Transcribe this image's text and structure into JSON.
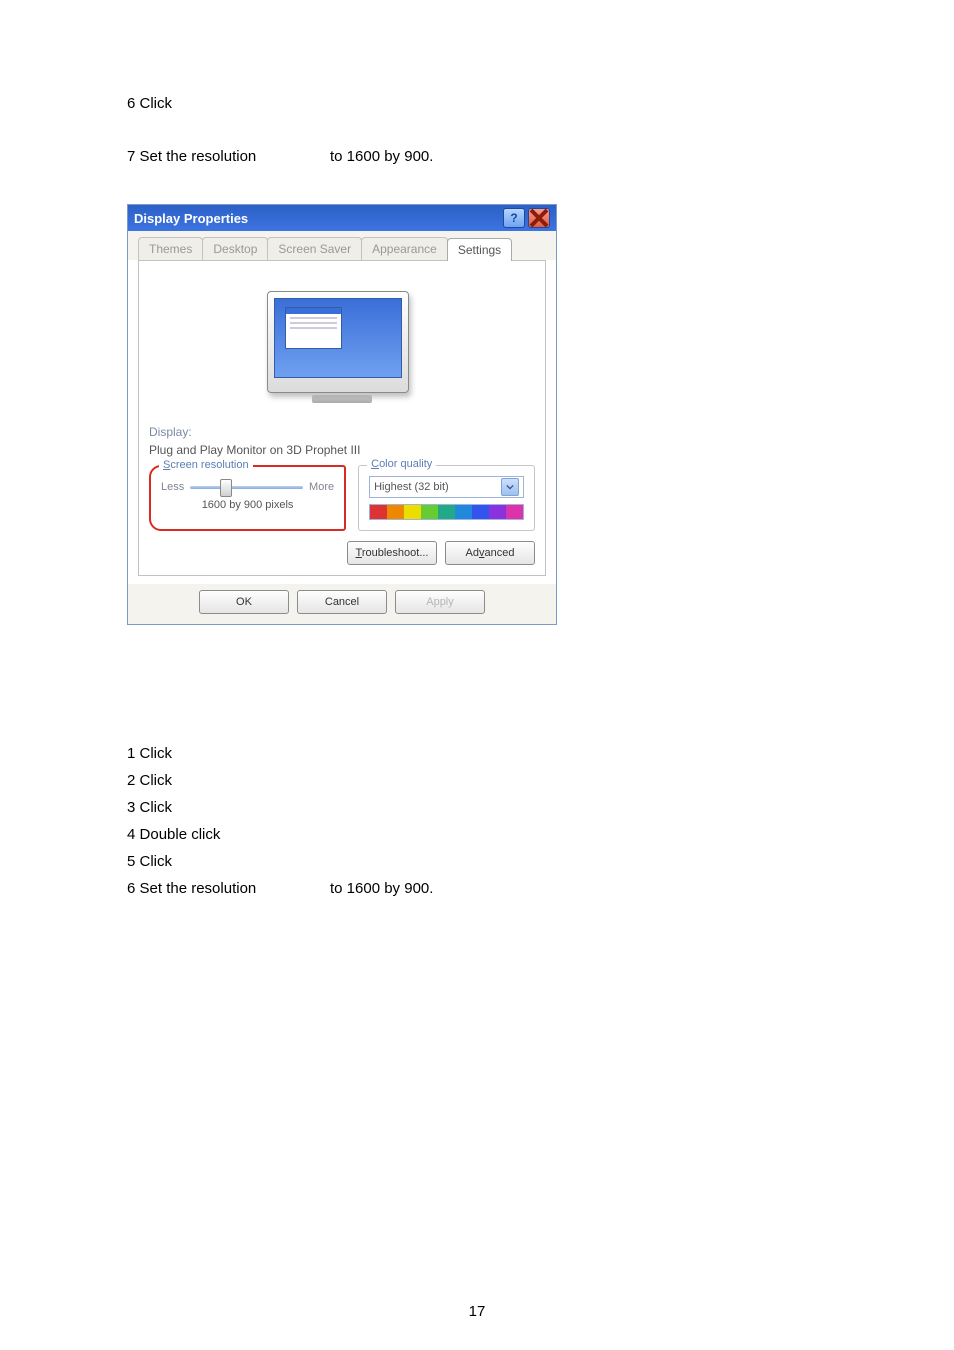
{
  "lines_top": [
    {
      "num": "6",
      "text": "Click"
    },
    {
      "num": "7",
      "text": "Set the resolution",
      "suffix": "to 1600 by 900."
    }
  ],
  "dialog": {
    "title": "Display Properties",
    "tabs": [
      "Themes",
      "Desktop",
      "Screen Saver",
      "Appearance",
      "Settings"
    ],
    "active_tab": 4,
    "display_label": "Display:",
    "display_value": "Plug and Play Monitor on 3D Prophet III",
    "group_resolution": {
      "legend": "Screen resolution",
      "less": "Less",
      "more": "More",
      "value": "1600 by 900 pixels"
    },
    "group_color": {
      "legend": "Color quality",
      "value": "Highest (32 bit)"
    },
    "buttons": {
      "troubleshoot": "Troubleshoot...",
      "advanced": "Advanced",
      "ok": "OK",
      "cancel": "Cancel",
      "apply": "Apply"
    }
  },
  "lines_bottom": [
    {
      "num": "1",
      "text": "Click"
    },
    {
      "num": "2",
      "text": "Click"
    },
    {
      "num": "3",
      "text": "Click"
    },
    {
      "num": "4",
      "text": "Double click"
    },
    {
      "num": "5",
      "text": "Click"
    },
    {
      "num": "6",
      "text": "Set the resolution",
      "suffix": "to 1600 by 900."
    }
  ],
  "page_number": "17"
}
